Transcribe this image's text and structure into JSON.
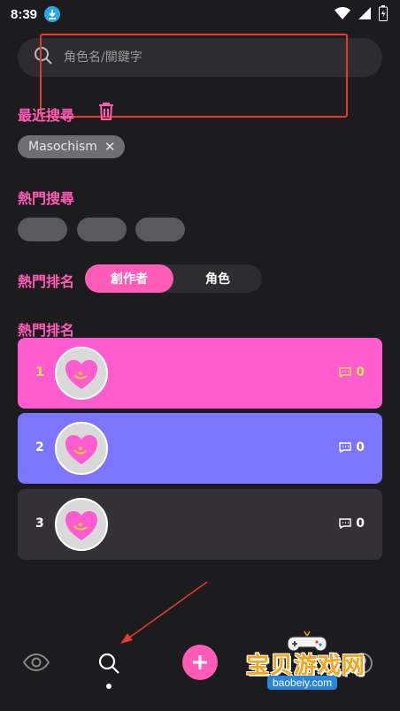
{
  "status_bar": {
    "time": "8:39"
  },
  "search": {
    "placeholder": "角色名/關鍵字",
    "value": ""
  },
  "recent": {
    "title": "最近搜尋",
    "chips": [
      "Masochism"
    ]
  },
  "hot_search": {
    "title": "熱門搜尋"
  },
  "ranking_toggle": {
    "title": "熱門排名",
    "options": [
      "創作者",
      "角色"
    ],
    "selected": "創作者"
  },
  "ranking_list": {
    "title": "熱門排名",
    "items": [
      {
        "rank": "1",
        "comments": "0",
        "color": "#ff5cd0"
      },
      {
        "rank": "2",
        "comments": "0",
        "color": "#7b75ff"
      },
      {
        "rank": "3",
        "comments": "0",
        "color": "#333135"
      }
    ]
  },
  "bottom_nav": {
    "items": [
      "eye-icon",
      "search-icon",
      "add-icon",
      "profile-icon"
    ],
    "active": "search-icon"
  },
  "watermark": {
    "title": "宝贝游戏网",
    "url": "baobeiy.com"
  },
  "colors": {
    "accent": "#ff5cb8",
    "background": "#1c1b1d",
    "annotation": "#e53b2c"
  }
}
